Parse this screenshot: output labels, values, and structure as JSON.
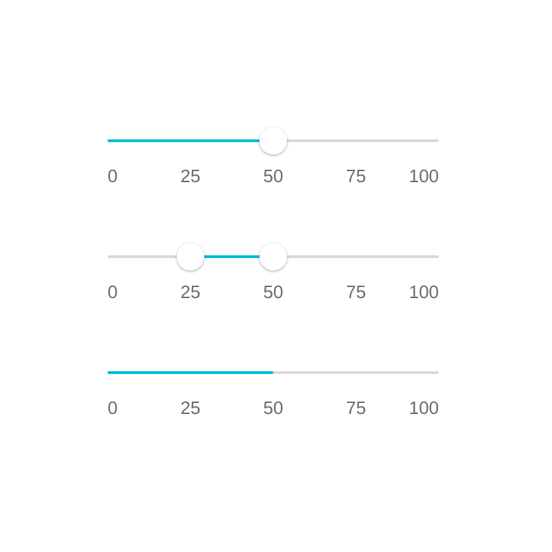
{
  "accent_color": "#00bcd9",
  "track_color": "#d9d9d9",
  "tick_color": "#6b6b6b",
  "scale": {
    "min": 0,
    "max": 100
  },
  "sliders": [
    {
      "type": "single",
      "value": 50,
      "has_thumb": true,
      "ticks": [
        "0",
        "25",
        "50",
        "75",
        "100"
      ]
    },
    {
      "type": "range",
      "values": [
        25,
        50
      ],
      "has_thumb": true,
      "ticks": [
        "0",
        "25",
        "50",
        "75",
        "100"
      ]
    },
    {
      "type": "single",
      "value": 50,
      "has_thumb": false,
      "ticks": [
        "0",
        "25",
        "50",
        "75",
        "100"
      ]
    }
  ]
}
